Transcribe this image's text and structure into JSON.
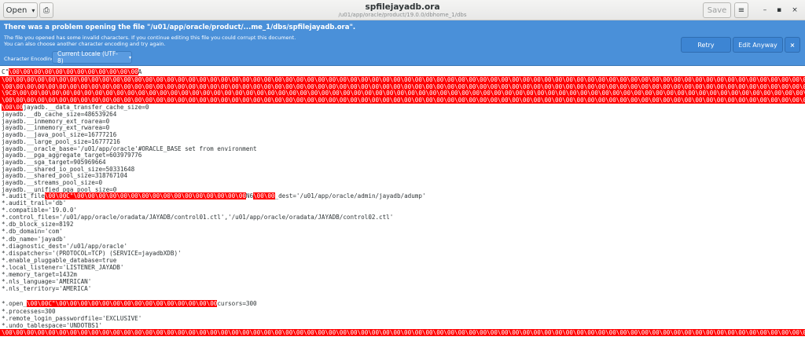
{
  "header": {
    "open_label": "Open",
    "open_caret": "▾",
    "newdoc_icon": "⎙",
    "title": "spfilejayadb.ora",
    "subtitle": "/u01/app/oracle/product/19.0.0/dbhome_1/dbs",
    "save_label": "Save",
    "menu_icon": "≡",
    "minimize_icon": "–",
    "maximize_icon": "▪",
    "close_icon": "×"
  },
  "infobar": {
    "title": "There was a problem opening the file \"/u01/app/oracle/product/...me_1/dbs/spfilejayadb.ora\".",
    "line1": "The file you opened has some invalid characters. If you continue editing this file you could corrupt this document.",
    "line2": "You can also choose another character encoding and try again.",
    "encoding_label": "Character Encoding:",
    "encoding_value": "Current Locale (UTF-8)",
    "encoding_caret": "▾",
    "retry_label": "Retry",
    "edit_anyway_label": "Edit Anyway",
    "close_label": "×"
  },
  "text": {
    "l0": "C\"",
    "l0b": "\\00\\00",
    "l0c": "\\00\\00\\00\\00\\00\\00\\00\\00\\00\\00",
    "l0d": "A",
    "bad1": "\\00\\00\\00\\00\\00\\00\\00\\00\\00\\00\\00\\00\\00\\00\\00\\00\\00\\00\\00\\00\\00\\00\\00\\00\\00\\00\\00\\00\\00\\00\\00\\00\\00\\00\\00\\00\\00\\00\\00\\00\\00\\00\\00\\00\\00\\00\\00\\00\\00\\00\\00\\00\\00\\00\\00\\00\\00\\00\\00\\00\\00\\00\\00\\00\\00\\00\\00\\00\\00\\00\\00\\00\\00\\00\\00\\00\\00\\00\\00\\00\\00\\00\\00\\00\\00\\00\\00\\00",
    "bad2": "\\00\\00\\00\\00\\00\\00\\00\\00\\00\\00\\00\\00\\00\\00\\00\\00\\00\\00\\00\\00\\00\\00\\00\\00\\00\\00\\00\\00\\00\\00\\00\\00\\00\\00\\00\\00\\00\\00\\00\\00\\00\\00\\00\\00\\00\\00\\00\\00\\00\\00\\00\\00\\00\\00\\00\\00\\00\\00\\00\\00\\00\\00\\00\\00\\00\\00\\00\\00\\00\\00\\00\\00\\00\\00\\00\\00\\00\\00\\00\\00\\00\\00\\00\\00\\00\\00\\00\\00",
    "bad3": "\\9C8\\00\\00\\00\\00\\00\\00\\00\\00\\00\\00\\00\\00\\00\\00\\00\\00\\00\\00\\00\\00\\00\\00\\00\\00\\00\\00\\00\\00\\00\\00\\00\\00\\00\\00\\00\\00\\00\\00\\00\\00\\00\\00\\00\\00\\00\\00\\00\\00\\00\\00\\00\\00\\00\\00\\00\\00\\00\\00\\00\\00\\00\\00\\00\\00\\00\\00\\00\\00\\00\\00\\00\\00\\00\\00\\00\\00\\00\\00\\00\\00\\00\\00\\00\\00\\00\\00\\00",
    "bad4": "\\00\\00\\00\\00\\00\\00\\00\\00\\00\\00\\00\\00\\00\\00\\00\\00\\00\\00\\00\\00\\00\\00\\00\\00\\00\\00\\00\\00\\00\\00\\00\\00\\00\\00\\00\\00\\00\\00\\00\\00\\00\\00\\00\\00\\00\\00\\00\\00\\00\\00\\00\\00\\00\\00\\00\\00\\00\\00\\00\\00\\00\\00\\00\\00\\00\\00\\00\\00\\00\\00\\00\\00\\00\\00\\00\\00\\00\\00\\00\\00\\00\\00\\00\\00\\00\\00\\00\\00",
    "l5a": "\\00\\00",
    "l5b": "jayadb.__data_transfer_cache_size=0",
    "params1": [
      "jayadb.__db_cache_size=486539264",
      "jayadb.__inmemory_ext_roarea=0",
      "jayadb.__inmemory_ext_rwarea=0",
      "jayadb.__java_pool_size=16777216",
      "jayadb.__large_pool_size=16777216",
      "jayadb.__oracle_base='/u01/app/oracle'#ORACLE_BASE set from environment",
      "jayadb.__pga_aggregate_target=603979776",
      "jayadb.__sga_target=905969664",
      "jayadb.__shared_io_pool_size=50331648",
      "jayadb.__shared_pool_size=318767104",
      "jayadb.__streams_pool_size=0",
      "jayadb.__unified_pga_pool_size=0"
    ],
    "audit_a": "*.audit_file",
    "audit_b": "\\00\\00C\"",
    "audit_c": "\\00\\00\\00\\00\\00\\00\\00\\00\\00\\00\\00\\00\\00\\00\\00\\00",
    "audit_d": "N6",
    "audit_e": "\\00\\00",
    "audit_f": "_dest='/u01/app/oracle/admin/jayadb/adump'",
    "params2": [
      "*.audit_trail='db'",
      "*.compatible='19.0.0'",
      "*.control_files='/u01/app/oracle/oradata/JAYADB/control01.ctl','/u01/app/oracle/oradata/JAYADB/control02.ctl'",
      "*.db_block_size=8192",
      "*.db_domain='com'",
      "*.db_name='jayadb'",
      "*.diagnostic_dest='/u01/app/oracle'",
      "*.dispatchers='(PROTOCOL=TCP) (SERVICE=jayadbXDB)'",
      "*.enable_pluggable_database=true",
      "*.local_listener='LISTENER_JAYADB'",
      "*.memory_target=1432m",
      "*.nls_language='AMERICAN'",
      "*.nls_territory='AMERICA'"
    ],
    "open_a": "*.open_",
    "open_b": "\\00\\00C\"",
    "open_c": "\\00\\00\\00\\00\\00\\00\\00\\00\\00\\00\\00\\00\\00",
    "open_d": "\\00\\00",
    "open_e": "cursors=300",
    "params3": [
      "*.processes=300",
      "*.remote_login_passwordfile='EXCLUSIVE'",
      "*.undo_tablespace='UNDOTBS1'"
    ],
    "bad_last": "\\00\\00\\00\\00\\00\\00\\00\\00\\00\\00\\00\\00\\00\\00\\00\\00\\00\\00\\00\\00\\00\\00\\00\\00\\00\\00\\00\\00\\00\\00\\00\\00\\00\\00\\00\\00\\00\\00\\00\\00\\00\\00\\00\\00\\00\\00\\00\\00\\00\\00\\00\\00\\00\\00\\00\\00\\00\\00\\00\\00\\00\\00\\00\\00\\00\\00\\00\\00\\00\\00\\00\\00\\00\\00\\00\\00\\00\\00\\00\\00\\00\\00\\00\\00\\00\\00\\00\\00"
  }
}
